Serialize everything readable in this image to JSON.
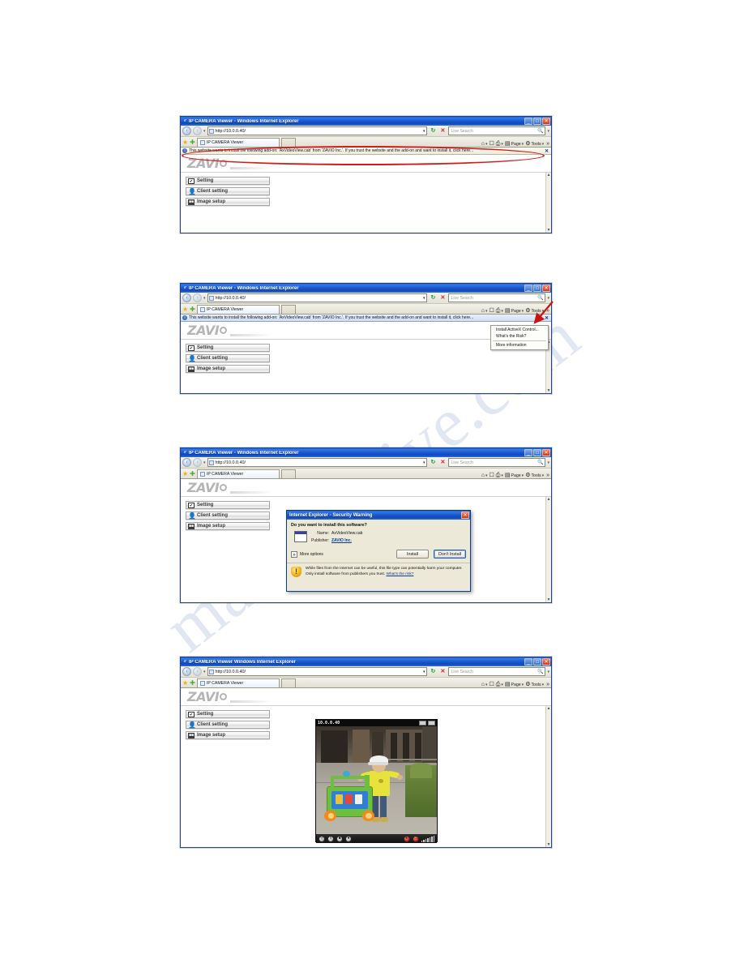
{
  "page": {
    "watermark": "manualshive.com"
  },
  "window": {
    "title": "IP CAMERA Viewer - Windows Internet Explorer",
    "title_plain": "IP CAMERA Viewer  Windows Internet Explorer",
    "address": "http://10.0.0.40/",
    "search_placeholder": "Live Search",
    "tab_label": "IP CAMERA Viewer",
    "toolbar": {
      "page": "Page",
      "tools": "Tools"
    },
    "buttons": {
      "minimize": "_",
      "maximize": "□",
      "close": "✕"
    }
  },
  "infobar": {
    "text": "This website wants to install the following add-on: 'AxVideoView.cab' from 'ZAVIO Inc.'. If you trust the website and the add-on and want to install it, click here...",
    "close": "✕"
  },
  "site": {
    "brand": "ZAVI",
    "nav": [
      {
        "label": "Setting",
        "icon": "checkbox-icon"
      },
      {
        "label": "Client setting",
        "icon": "person-icon"
      },
      {
        "label": "Image setup",
        "icon": "camera-icon"
      }
    ]
  },
  "context_menu": {
    "items": [
      "Install ActiveX Control...",
      "What's the Risk?",
      "More information"
    ]
  },
  "dialog": {
    "title": "Internet Explorer - Security Warning",
    "question": "Do you want to install this software?",
    "fields": [
      {
        "key": "Name:",
        "value": "AxVideoView.cab"
      },
      {
        "key": "Publisher:",
        "value": "ZAVIO Inc."
      }
    ],
    "more_options": "More options",
    "more_options_glyph": "»",
    "install": "Install",
    "dont_install": "Don't Install",
    "footer_text": "While files from the Internet can be useful, this file type can potentially harm your computer. Only install software from publishers you trust.",
    "footer_link": "What's the risk?",
    "close": "✕"
  },
  "player": {
    "ip": "10.0.0.40",
    "controls": [
      {
        "name": "zoom-icon",
        "glyph": "⚲"
      },
      {
        "name": "pause-icon",
        "glyph": "‖"
      },
      {
        "name": "stop-icon",
        "glyph": "■"
      },
      {
        "name": "snapshot-icon",
        "glyph": "●"
      },
      {
        "name": "record-icon",
        "glyph": "●"
      },
      {
        "name": "power-icon",
        "glyph": "⏻"
      }
    ]
  }
}
